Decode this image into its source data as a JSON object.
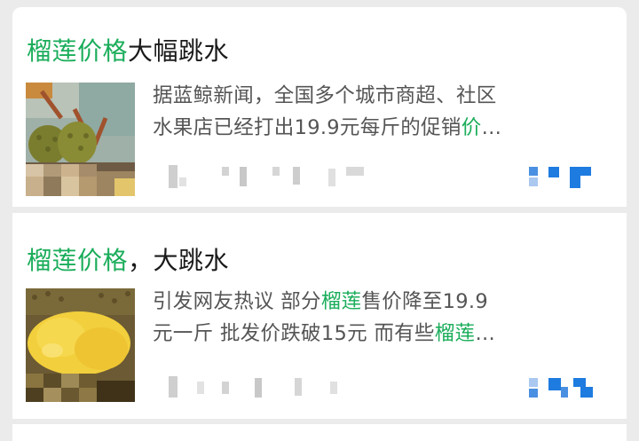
{
  "results": [
    {
      "title_highlight": "榴莲价格",
      "title_rest": "大幅跳水",
      "snippet_line1": "据蓝鲸新闻，全国多个城市商超、社区",
      "snippet_line2_a": "水果店已经打出19.9元每斤的促销",
      "snippet_line2_hl": "价",
      "snippet_line2_ellipsis": "…",
      "thumbnail": "durian-stall-photo",
      "source_icon": "blurred-source-logo"
    },
    {
      "title_highlight": "榴莲价格",
      "title_rest": "，大跳水",
      "snippet_line1_a": "引发网友热议 部分",
      "snippet_line1_hl": "榴莲",
      "snippet_line1_b": "售价降至19.9",
      "snippet_line2_a": "元一斤 批发价跌破15元 而有些",
      "snippet_line2_hl": "榴莲",
      "snippet_line2_ellipsis": "…",
      "thumbnail": "durian-flesh-photo",
      "source_icon": "blurred-source-logo"
    }
  ],
  "colors": {
    "highlight": "#1aad5a",
    "text": "#1a1a1a",
    "snippet": "#555555"
  }
}
